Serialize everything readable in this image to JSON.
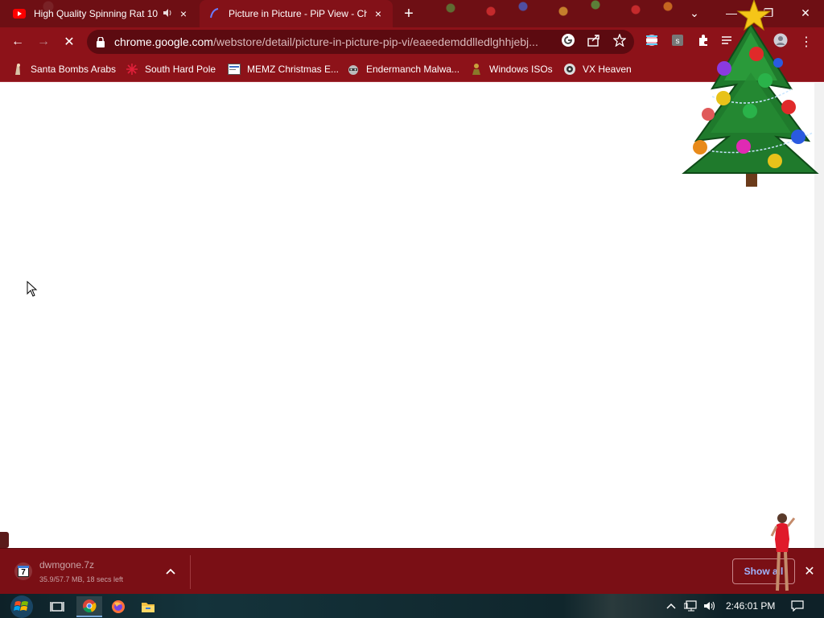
{
  "tabs": [
    {
      "title": "High Quality Spinning Rat 10",
      "favicon": "youtube-icon",
      "audio": "speaker-icon",
      "close": "×"
    },
    {
      "title": "Picture in Picture - PiP View - Ch",
      "favicon": "pip-icon",
      "close": "×"
    }
  ],
  "new_tab_label": "+",
  "window": {
    "tab_search": "⌄",
    "minimize": "—",
    "restore": "❐",
    "close": "✕"
  },
  "toolbar": {
    "back": "←",
    "forward": "→",
    "stop": "✕",
    "url_host": "chrome.google.com",
    "url_path": "/webstore/detail/picture-in-picture-pip-vi/eaeedemddlledlghhjebj...",
    "menu": "⋮"
  },
  "bookmarks": [
    {
      "label": "Santa Bombs Arabs",
      "icon": "santa-icon"
    },
    {
      "label": "South Hard Pole",
      "icon": "snowflake-icon"
    },
    {
      "label": "MEMZ Christmas E...",
      "icon": "page-icon"
    },
    {
      "label": "Endermanch Malwa...",
      "icon": "raccoon-icon"
    },
    {
      "label": "Windows ISOs",
      "icon": "figure-icon"
    },
    {
      "label": "VX Heaven",
      "icon": "vx-icon"
    }
  ],
  "download": {
    "file_name": "dwmgone.7z",
    "status": "35.9/57.7 MB, 18 secs left",
    "show_all": "Show all",
    "close": "✕",
    "progress": 0.62
  },
  "taskbar": {
    "clock": "2:46:01 PM"
  },
  "colors": {
    "frame": "#6e0f14",
    "toolbar": "#8d1219",
    "omnibox": "#5c0a10",
    "shelf": "#7a0f15",
    "taskbar": "#0e2128"
  }
}
